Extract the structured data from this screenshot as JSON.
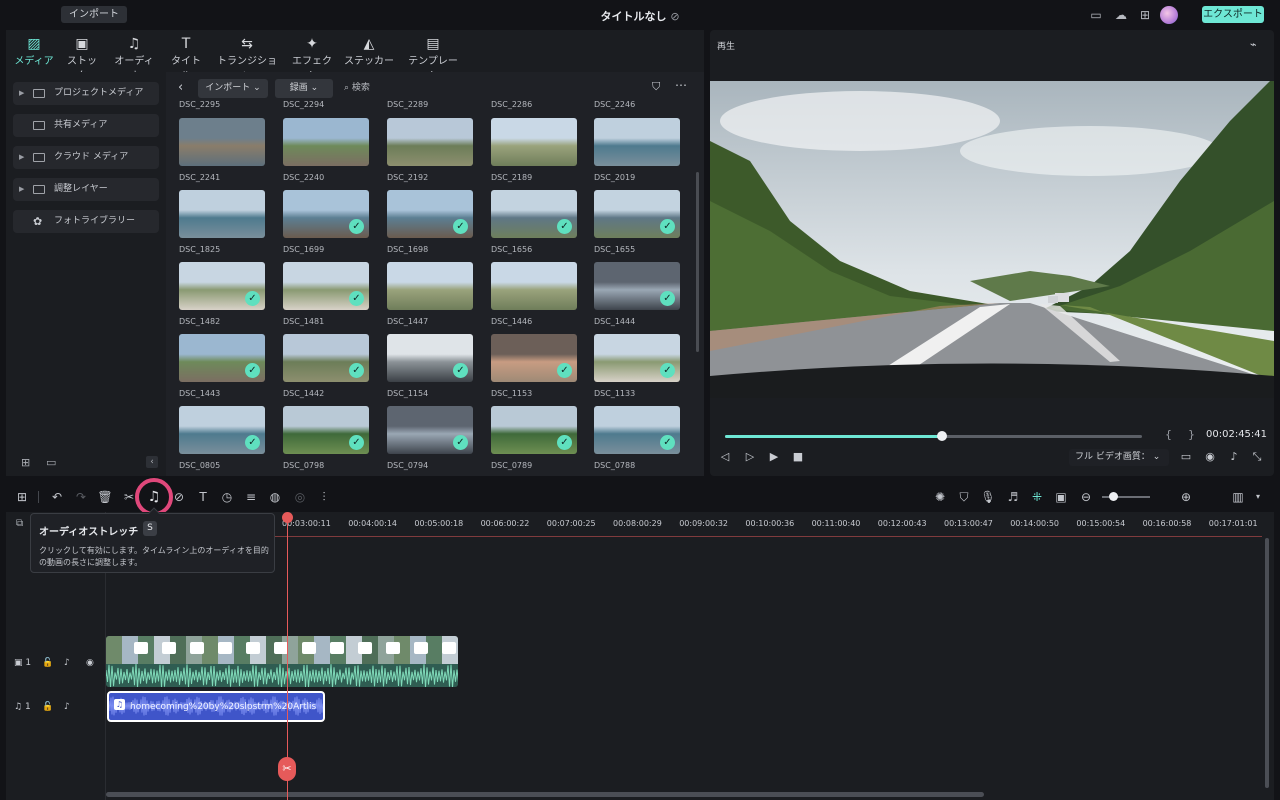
{
  "titlebar": {
    "import_label": "インポート",
    "title": "タイトルなし",
    "export_label": "エクスポート"
  },
  "categories": [
    {
      "label": "メディア",
      "icon": "media-icon",
      "active": true
    },
    {
      "label": "ストック",
      "icon": "stock-icon",
      "active": false
    },
    {
      "label": "オーディオ",
      "icon": "audio-icon",
      "active": false
    },
    {
      "label": "タイトル",
      "icon": "title-icon",
      "active": false
    },
    {
      "label": "トランジション",
      "icon": "transition-icon",
      "active": false
    },
    {
      "label": "エフェクト",
      "icon": "effect-icon",
      "active": false
    },
    {
      "label": "ステッカー",
      "icon": "sticker-icon",
      "active": false
    },
    {
      "label": "テンプレート",
      "icon": "template-icon",
      "active": false
    }
  ],
  "sidebar": {
    "items": [
      {
        "label": "プロジェクトメディア",
        "expandable": true
      },
      {
        "label": "共有メディア",
        "expandable": false
      },
      {
        "label": "クラウド メディア",
        "expandable": true
      },
      {
        "label": "調整レイヤー",
        "expandable": true
      },
      {
        "label": "フォトライブラリー",
        "expandable": false
      }
    ]
  },
  "filter": {
    "import_dropdown": "インポート",
    "record_dropdown": "録画",
    "search_placeholder": "検索"
  },
  "media": {
    "top_labels": [
      "DSC_2295",
      "DSC_2294",
      "DSC_2289",
      "DSC_2286",
      "DSC_2246"
    ],
    "rows": [
      [
        {
          "name": "DSC_2241",
          "checked": false,
          "scene": "water"
        },
        {
          "name": "DSC_2240",
          "checked": false,
          "scene": "road"
        },
        {
          "name": "DSC_2192",
          "checked": false,
          "scene": "hill"
        },
        {
          "name": "DSC_2189",
          "checked": false,
          "scene": "plain"
        },
        {
          "name": "DSC_2019",
          "checked": false,
          "scene": "sea"
        }
      ],
      [
        {
          "name": "DSC_1825",
          "checked": false,
          "scene": "sea"
        },
        {
          "name": "DSC_1699",
          "checked": true,
          "scene": "pier"
        },
        {
          "name": "DSC_1698",
          "checked": true,
          "scene": "pier"
        },
        {
          "name": "DSC_1656",
          "checked": true,
          "scene": "town"
        },
        {
          "name": "DSC_1655",
          "checked": true,
          "scene": "town"
        }
      ],
      [
        {
          "name": "DSC_1482",
          "checked": true,
          "scene": "person"
        },
        {
          "name": "DSC_1481",
          "checked": true,
          "scene": "person"
        },
        {
          "name": "DSC_1447",
          "checked": false,
          "scene": "plain"
        },
        {
          "name": "DSC_1446",
          "checked": false,
          "scene": "plain"
        },
        {
          "name": "DSC_1444",
          "checked": true,
          "scene": "car"
        }
      ],
      [
        {
          "name": "DSC_1443",
          "checked": true,
          "scene": "road"
        },
        {
          "name": "DSC_1442",
          "checked": true,
          "scene": "hill"
        },
        {
          "name": "DSC_1154",
          "checked": true,
          "scene": "blur"
        },
        {
          "name": "DSC_1153",
          "checked": true,
          "scene": "cave"
        },
        {
          "name": "DSC_1133",
          "checked": true,
          "scene": "person"
        }
      ],
      [
        {
          "name": "DSC_0805",
          "checked": true,
          "scene": "sea"
        },
        {
          "name": "DSC_0798",
          "checked": true,
          "scene": "forest"
        },
        {
          "name": "DSC_0794",
          "checked": true,
          "scene": "car"
        },
        {
          "name": "DSC_0789",
          "checked": true,
          "scene": "forest"
        },
        {
          "name": "DSC_0788",
          "checked": true,
          "scene": "sea"
        }
      ]
    ]
  },
  "player": {
    "label": "再生",
    "timecode": "00:02:45:41",
    "progress": 0.52,
    "quality_label": "フル ビデオ画質：",
    "mark_in": "{",
    "mark_out": "}"
  },
  "tooltip": {
    "title": "オーディオストレッチ",
    "shortcut": "S",
    "description": "クリックして有効にします。タイムライン上のオーディオを目的の動画の長さに調整します。"
  },
  "timeline": {
    "ruler_labels": [
      "00:03:00:11",
      "00:04:00:14",
      "00:05:00:18",
      "00:06:00:22",
      "00:07:00:25",
      "00:08:00:29",
      "00:09:00:32",
      "00:10:00:36",
      "00:11:00:40",
      "00:12:00:43",
      "00:13:00:47",
      "00:14:00:50",
      "00:15:00:54",
      "00:16:00:58",
      "00:17:01:01"
    ],
    "video_track_label": "1",
    "audio_track_label": "1",
    "audio_clip_name": "homecoming%20by%20slpstrm%20Artlis"
  },
  "colors": {
    "accent": "#6ee7d5",
    "playhead": "#e65a5a",
    "highlight": "#e0487b",
    "audio_clip": "#3f55c9"
  }
}
